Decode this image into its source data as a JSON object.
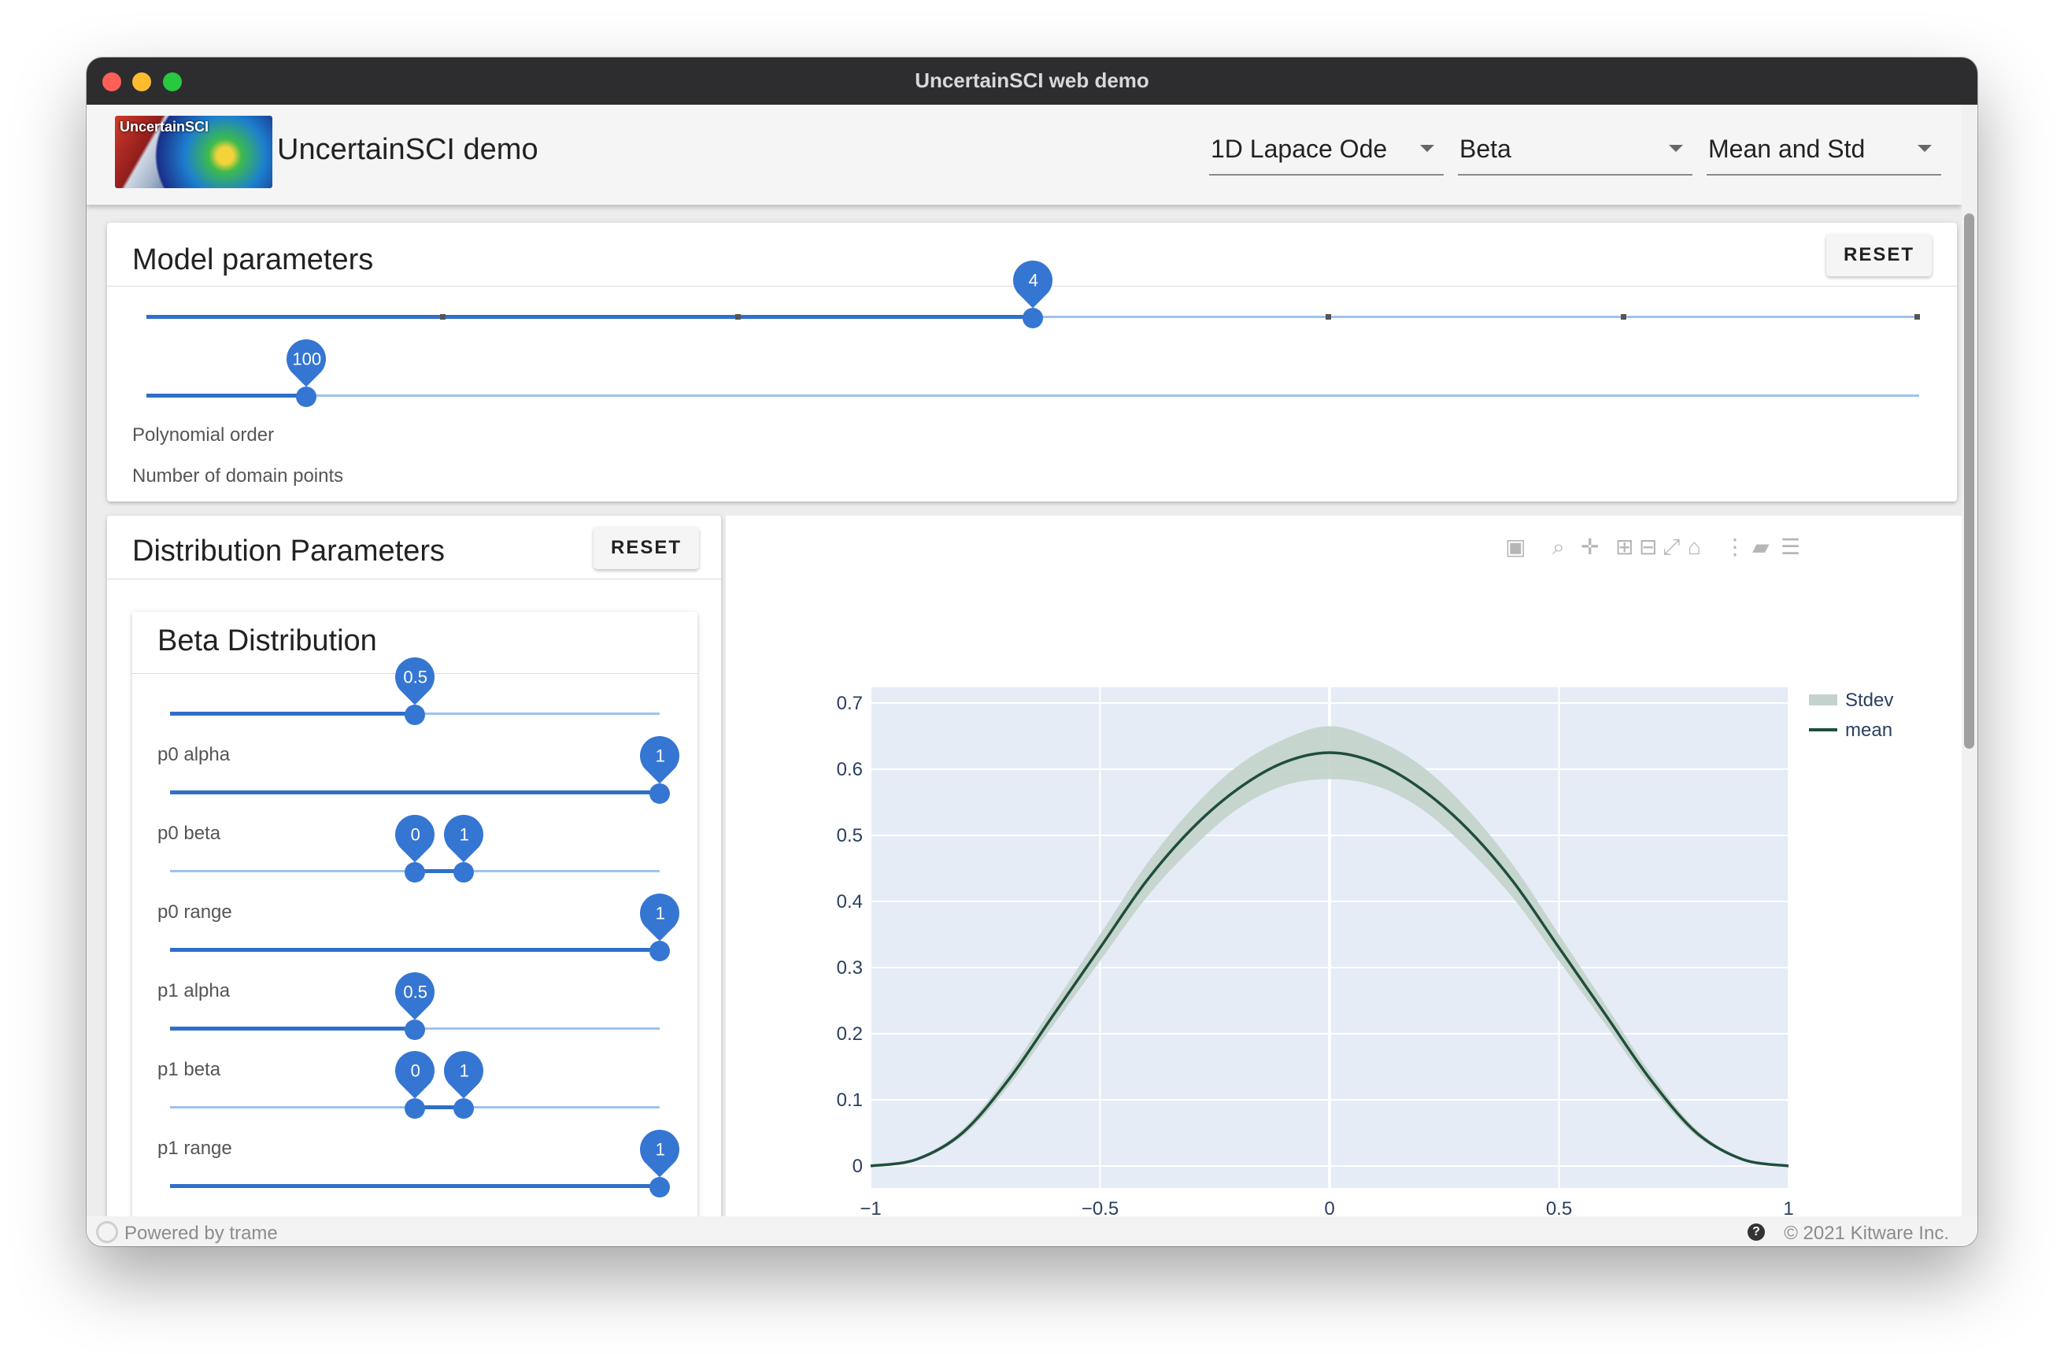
{
  "window": {
    "title": "UncertainSCI web demo"
  },
  "header": {
    "logo_text": "UncertainSCI",
    "app_title": "UncertainSCI demo",
    "selects": [
      {
        "value": "1D Lapace Ode"
      },
      {
        "value": "Beta"
      },
      {
        "value": "Mean and Std"
      }
    ]
  },
  "model_params": {
    "title": "Model parameters",
    "reset_label": "RESET",
    "polynomial_order": {
      "label": "Polynomial order",
      "value": "4",
      "fraction": 0.5
    },
    "domain_points": {
      "label": "Number of domain points",
      "value": "100",
      "fraction": 0.09
    }
  },
  "dist_params": {
    "title": "Distribution Parameters",
    "reset_label": "RESET",
    "sub_title": "Beta Distribution",
    "sliders": [
      {
        "label": "p0 alpha",
        "type": "single",
        "value": "0.5",
        "fraction": 0.5
      },
      {
        "label": "p0 beta",
        "type": "single",
        "value": "1",
        "fraction": 1.0
      },
      {
        "label": "p0 range",
        "type": "range",
        "low": "0",
        "high": "1",
        "low_fraction": 0.5,
        "high_fraction": 0.6
      },
      {
        "label": "p1 alpha",
        "type": "single",
        "value": "1",
        "fraction": 1.0
      },
      {
        "label": "p1 beta",
        "type": "single",
        "value": "0.5",
        "fraction": 0.5
      },
      {
        "label": "p1 range",
        "type": "range",
        "low": "0",
        "high": "1",
        "low_fraction": 0.5,
        "high_fraction": 0.6
      },
      {
        "label": "",
        "type": "single",
        "value": "1",
        "fraction": 1.0
      }
    ]
  },
  "modebar": {
    "icons": [
      "camera-icon",
      "zoom-icon",
      "pan-icon",
      "zoom-in-icon",
      "zoom-out-icon",
      "autoscale-icon",
      "home-icon",
      "spike-lines-icon",
      "hover-closest-icon",
      "hover-compare-icon"
    ]
  },
  "chart_data": {
    "type": "line",
    "title": "",
    "xlabel": "",
    "ylabel": "",
    "xlim": [
      -1,
      1
    ],
    "ylim": [
      0,
      0.7
    ],
    "x_ticks": [
      "−1",
      "−0.5",
      "0",
      "0.5",
      "1"
    ],
    "y_ticks": [
      "0",
      "0.1",
      "0.2",
      "0.3",
      "0.4",
      "0.5",
      "0.6",
      "0.7"
    ],
    "grid": true,
    "legend_position": "top-right",
    "colors": {
      "mean": "#1f4e3d",
      "stdev": "#c3d3cb",
      "plot_bg": "#e5ecf6"
    },
    "x": [
      -1,
      -0.9,
      -0.8,
      -0.7,
      -0.6,
      -0.5,
      -0.4,
      -0.3,
      -0.2,
      -0.1,
      0,
      0.1,
      0.2,
      0.3,
      0.4,
      0.5,
      0.6,
      0.7,
      0.8,
      0.9,
      1
    ],
    "series": [
      {
        "name": "mean",
        "values": [
          0.0,
          0.01,
          0.05,
          0.13,
          0.23,
          0.33,
          0.43,
          0.51,
          0.57,
          0.61,
          0.625,
          0.61,
          0.57,
          0.51,
          0.43,
          0.33,
          0.23,
          0.13,
          0.05,
          0.01,
          0.0
        ]
      },
      {
        "name": "Stdev",
        "lower": [
          0.0,
          0.01,
          0.045,
          0.12,
          0.215,
          0.31,
          0.405,
          0.48,
          0.54,
          0.575,
          0.585,
          0.575,
          0.54,
          0.48,
          0.405,
          0.31,
          0.215,
          0.12,
          0.045,
          0.01,
          0.0
        ],
        "upper": [
          0.0,
          0.012,
          0.055,
          0.14,
          0.245,
          0.35,
          0.455,
          0.54,
          0.605,
          0.645,
          0.665,
          0.645,
          0.605,
          0.54,
          0.455,
          0.35,
          0.245,
          0.14,
          0.055,
          0.012,
          0.0
        ]
      }
    ]
  },
  "footer": {
    "powered": "Powered by trame",
    "copyright": "© 2021 Kitware Inc.",
    "help": "?"
  }
}
